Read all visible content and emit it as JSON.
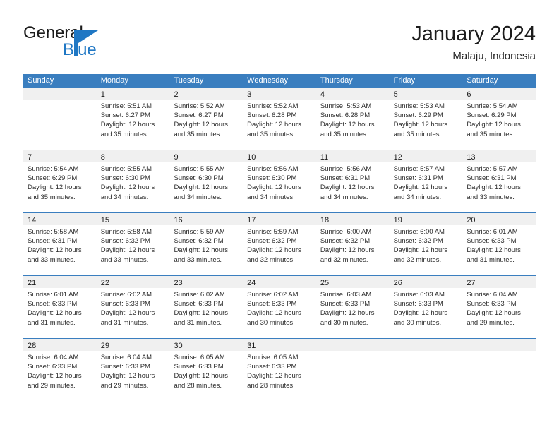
{
  "brand": {
    "general": "General",
    "blue": "Blue",
    "mark": "triangle-logo-icon"
  },
  "header": {
    "title": "January 2024",
    "subtitle": "Malaju, Indonesia"
  },
  "colors": {
    "header_blue": "#3a7ebf",
    "brand_blue": "#1f77c4",
    "day_band": "#f0f0f0",
    "text": "#2b2b2b"
  },
  "weekdays": [
    "Sunday",
    "Monday",
    "Tuesday",
    "Wednesday",
    "Thursday",
    "Friday",
    "Saturday"
  ],
  "weeks": [
    [
      {
        "day": "",
        "sunrise": "",
        "sunset": "",
        "daylight1": "",
        "daylight2": ""
      },
      {
        "day": "1",
        "sunrise": "Sunrise: 5:51 AM",
        "sunset": "Sunset: 6:27 PM",
        "daylight1": "Daylight: 12 hours",
        "daylight2": "and 35 minutes."
      },
      {
        "day": "2",
        "sunrise": "Sunrise: 5:52 AM",
        "sunset": "Sunset: 6:27 PM",
        "daylight1": "Daylight: 12 hours",
        "daylight2": "and 35 minutes."
      },
      {
        "day": "3",
        "sunrise": "Sunrise: 5:52 AM",
        "sunset": "Sunset: 6:28 PM",
        "daylight1": "Daylight: 12 hours",
        "daylight2": "and 35 minutes."
      },
      {
        "day": "4",
        "sunrise": "Sunrise: 5:53 AM",
        "sunset": "Sunset: 6:28 PM",
        "daylight1": "Daylight: 12 hours",
        "daylight2": "and 35 minutes."
      },
      {
        "day": "5",
        "sunrise": "Sunrise: 5:53 AM",
        "sunset": "Sunset: 6:29 PM",
        "daylight1": "Daylight: 12 hours",
        "daylight2": "and 35 minutes."
      },
      {
        "day": "6",
        "sunrise": "Sunrise: 5:54 AM",
        "sunset": "Sunset: 6:29 PM",
        "daylight1": "Daylight: 12 hours",
        "daylight2": "and 35 minutes."
      }
    ],
    [
      {
        "day": "7",
        "sunrise": "Sunrise: 5:54 AM",
        "sunset": "Sunset: 6:29 PM",
        "daylight1": "Daylight: 12 hours",
        "daylight2": "and 35 minutes."
      },
      {
        "day": "8",
        "sunrise": "Sunrise: 5:55 AM",
        "sunset": "Sunset: 6:30 PM",
        "daylight1": "Daylight: 12 hours",
        "daylight2": "and 34 minutes."
      },
      {
        "day": "9",
        "sunrise": "Sunrise: 5:55 AM",
        "sunset": "Sunset: 6:30 PM",
        "daylight1": "Daylight: 12 hours",
        "daylight2": "and 34 minutes."
      },
      {
        "day": "10",
        "sunrise": "Sunrise: 5:56 AM",
        "sunset": "Sunset: 6:30 PM",
        "daylight1": "Daylight: 12 hours",
        "daylight2": "and 34 minutes."
      },
      {
        "day": "11",
        "sunrise": "Sunrise: 5:56 AM",
        "sunset": "Sunset: 6:31 PM",
        "daylight1": "Daylight: 12 hours",
        "daylight2": "and 34 minutes."
      },
      {
        "day": "12",
        "sunrise": "Sunrise: 5:57 AM",
        "sunset": "Sunset: 6:31 PM",
        "daylight1": "Daylight: 12 hours",
        "daylight2": "and 34 minutes."
      },
      {
        "day": "13",
        "sunrise": "Sunrise: 5:57 AM",
        "sunset": "Sunset: 6:31 PM",
        "daylight1": "Daylight: 12 hours",
        "daylight2": "and 33 minutes."
      }
    ],
    [
      {
        "day": "14",
        "sunrise": "Sunrise: 5:58 AM",
        "sunset": "Sunset: 6:31 PM",
        "daylight1": "Daylight: 12 hours",
        "daylight2": "and 33 minutes."
      },
      {
        "day": "15",
        "sunrise": "Sunrise: 5:58 AM",
        "sunset": "Sunset: 6:32 PM",
        "daylight1": "Daylight: 12 hours",
        "daylight2": "and 33 minutes."
      },
      {
        "day": "16",
        "sunrise": "Sunrise: 5:59 AM",
        "sunset": "Sunset: 6:32 PM",
        "daylight1": "Daylight: 12 hours",
        "daylight2": "and 33 minutes."
      },
      {
        "day": "17",
        "sunrise": "Sunrise: 5:59 AM",
        "sunset": "Sunset: 6:32 PM",
        "daylight1": "Daylight: 12 hours",
        "daylight2": "and 32 minutes."
      },
      {
        "day": "18",
        "sunrise": "Sunrise: 6:00 AM",
        "sunset": "Sunset: 6:32 PM",
        "daylight1": "Daylight: 12 hours",
        "daylight2": "and 32 minutes."
      },
      {
        "day": "19",
        "sunrise": "Sunrise: 6:00 AM",
        "sunset": "Sunset: 6:32 PM",
        "daylight1": "Daylight: 12 hours",
        "daylight2": "and 32 minutes."
      },
      {
        "day": "20",
        "sunrise": "Sunrise: 6:01 AM",
        "sunset": "Sunset: 6:33 PM",
        "daylight1": "Daylight: 12 hours",
        "daylight2": "and 31 minutes."
      }
    ],
    [
      {
        "day": "21",
        "sunrise": "Sunrise: 6:01 AM",
        "sunset": "Sunset: 6:33 PM",
        "daylight1": "Daylight: 12 hours",
        "daylight2": "and 31 minutes."
      },
      {
        "day": "22",
        "sunrise": "Sunrise: 6:02 AM",
        "sunset": "Sunset: 6:33 PM",
        "daylight1": "Daylight: 12 hours",
        "daylight2": "and 31 minutes."
      },
      {
        "day": "23",
        "sunrise": "Sunrise: 6:02 AM",
        "sunset": "Sunset: 6:33 PM",
        "daylight1": "Daylight: 12 hours",
        "daylight2": "and 31 minutes."
      },
      {
        "day": "24",
        "sunrise": "Sunrise: 6:02 AM",
        "sunset": "Sunset: 6:33 PM",
        "daylight1": "Daylight: 12 hours",
        "daylight2": "and 30 minutes."
      },
      {
        "day": "25",
        "sunrise": "Sunrise: 6:03 AM",
        "sunset": "Sunset: 6:33 PM",
        "daylight1": "Daylight: 12 hours",
        "daylight2": "and 30 minutes."
      },
      {
        "day": "26",
        "sunrise": "Sunrise: 6:03 AM",
        "sunset": "Sunset: 6:33 PM",
        "daylight1": "Daylight: 12 hours",
        "daylight2": "and 30 minutes."
      },
      {
        "day": "27",
        "sunrise": "Sunrise: 6:04 AM",
        "sunset": "Sunset: 6:33 PM",
        "daylight1": "Daylight: 12 hours",
        "daylight2": "and 29 minutes."
      }
    ],
    [
      {
        "day": "28",
        "sunrise": "Sunrise: 6:04 AM",
        "sunset": "Sunset: 6:33 PM",
        "daylight1": "Daylight: 12 hours",
        "daylight2": "and 29 minutes."
      },
      {
        "day": "29",
        "sunrise": "Sunrise: 6:04 AM",
        "sunset": "Sunset: 6:33 PM",
        "daylight1": "Daylight: 12 hours",
        "daylight2": "and 29 minutes."
      },
      {
        "day": "30",
        "sunrise": "Sunrise: 6:05 AM",
        "sunset": "Sunset: 6:33 PM",
        "daylight1": "Daylight: 12 hours",
        "daylight2": "and 28 minutes."
      },
      {
        "day": "31",
        "sunrise": "Sunrise: 6:05 AM",
        "sunset": "Sunset: 6:33 PM",
        "daylight1": "Daylight: 12 hours",
        "daylight2": "and 28 minutes."
      },
      {
        "day": "",
        "sunrise": "",
        "sunset": "",
        "daylight1": "",
        "daylight2": ""
      },
      {
        "day": "",
        "sunrise": "",
        "sunset": "",
        "daylight1": "",
        "daylight2": ""
      },
      {
        "day": "",
        "sunrise": "",
        "sunset": "",
        "daylight1": "",
        "daylight2": ""
      }
    ]
  ]
}
